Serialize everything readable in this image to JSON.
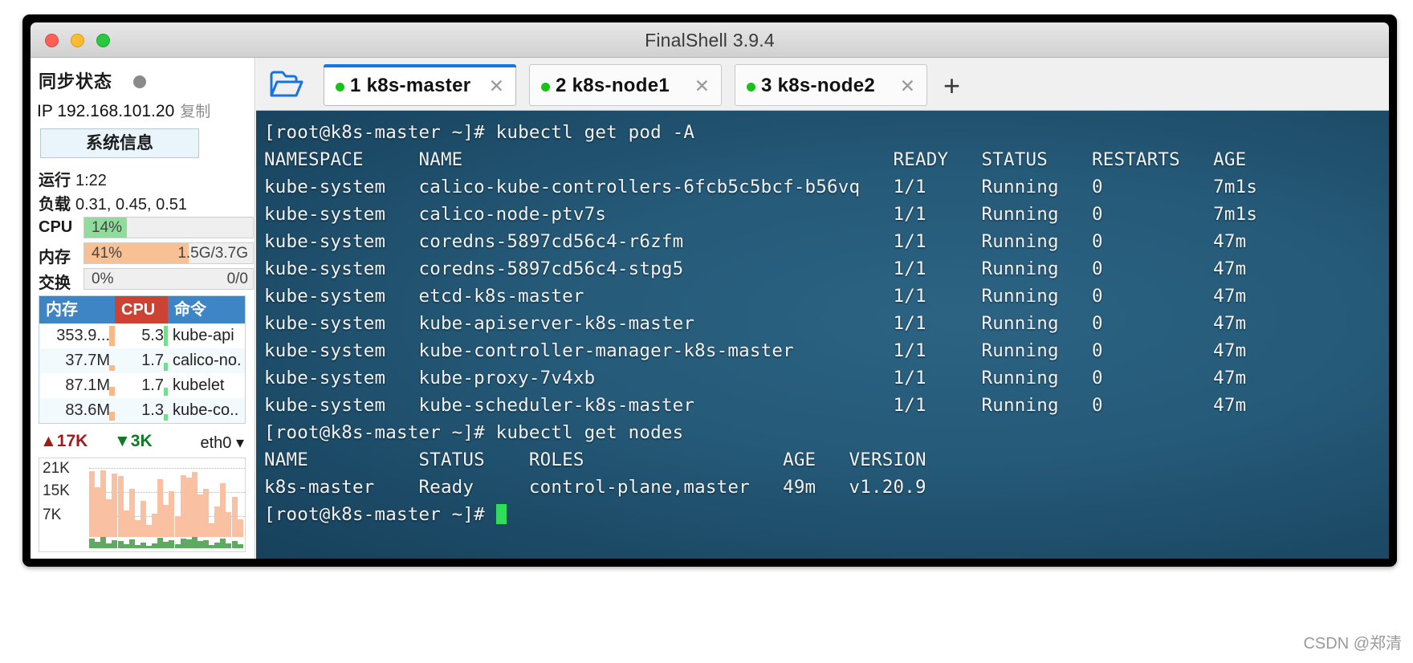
{
  "window": {
    "title": "FinalShell 3.9.4",
    "traffic_lights": [
      "close",
      "minimize",
      "maximize"
    ]
  },
  "sidebar": {
    "sync_label": "同步状态",
    "ip_prefix": "IP",
    "ip_address": "192.168.101.20",
    "copy_label": "复制",
    "sysinfo_button": "系统信息",
    "uptime_label": "运行",
    "uptime_value": "1:22",
    "load_label": "负载",
    "load_value": "0.31, 0.45, 0.51",
    "metrics": [
      {
        "name": "CPU",
        "percent": "14%",
        "value": "",
        "fill_pct": 25,
        "fill_color": "#8fdd9b"
      },
      {
        "name": "内存",
        "percent": "41%",
        "value": "1.5G/3.7G",
        "fill_pct": 62,
        "fill_color": "#f9c193"
      },
      {
        "name": "交换",
        "percent": "0%",
        "value": "0/0",
        "fill_pct": 0,
        "fill_color": "#f9c193"
      }
    ],
    "process_table": {
      "headers": [
        "内存",
        "CPU",
        "命令"
      ],
      "rows": [
        {
          "mem": "353.9...",
          "cpu": "5.3",
          "cmd": "kube-api",
          "mem_bar": 100,
          "cpu_bar": 100
        },
        {
          "mem": "37.7M",
          "cpu": "1.7",
          "cmd": "calico-no.",
          "mem_bar": 30,
          "cpu_bar": 40
        },
        {
          "mem": "87.1M",
          "cpu": "1.7",
          "cmd": "kubelet",
          "mem_bar": 45,
          "cpu_bar": 40
        },
        {
          "mem": "83.6M",
          "cpu": "1.3",
          "cmd": "kube-co..",
          "mem_bar": 43,
          "cpu_bar": 32
        }
      ]
    },
    "network": {
      "up_value": "17K",
      "down_value": "3K",
      "interface": "eth0",
      "y_ticks": [
        "21K",
        "15K",
        "7K"
      ],
      "bars": [
        95,
        72,
        96,
        55,
        92,
        88,
        38,
        70,
        24,
        52,
        18,
        34,
        84,
        46,
        66,
        30,
        90,
        86,
        94,
        62,
        70,
        20,
        44,
        78,
        36,
        58,
        26
      ],
      "baseline_bars": [
        12,
        8,
        14,
        6,
        10,
        9,
        5,
        11,
        4,
        7,
        3,
        6,
        13,
        8,
        10,
        5,
        12,
        11,
        14,
        9,
        10,
        4,
        7,
        12,
        6,
        9,
        5
      ]
    }
  },
  "tabs": {
    "folder_icon": "folder-open-icon",
    "add_label": "+",
    "close_glyph": "✕",
    "items": [
      {
        "label": "1 k8s-master",
        "active": true,
        "status": "connected"
      },
      {
        "label": "2 k8s-node1",
        "active": false,
        "status": "connected"
      },
      {
        "label": "3 k8s-node2",
        "active": false,
        "status": "connected"
      }
    ]
  },
  "terminal": {
    "lines": [
      "[root@k8s-master ~]# kubectl get pod -A",
      "NAMESPACE     NAME                                       READY   STATUS    RESTARTS   AGE",
      "kube-system   calico-kube-controllers-6fcb5c5bcf-b56vq   1/1     Running   0          7m1s",
      "kube-system   calico-node-ptv7s                          1/1     Running   0          7m1s",
      "kube-system   coredns-5897cd56c4-r6zfm                   1/1     Running   0          47m",
      "kube-system   coredns-5897cd56c4-stpg5                   1/1     Running   0          47m",
      "kube-system   etcd-k8s-master                            1/1     Running   0          47m",
      "kube-system   kube-apiserver-k8s-master                  1/1     Running   0          47m",
      "kube-system   kube-controller-manager-k8s-master         1/1     Running   0          47m",
      "kube-system   kube-proxy-7v4xb                           1/1     Running   0          47m",
      "kube-system   kube-scheduler-k8s-master                  1/1     Running   0          47m",
      "[root@k8s-master ~]# kubectl get nodes",
      "NAME          STATUS    ROLES                  AGE   VERSION",
      "k8s-master    Ready     control-plane,master   49m   v1.20.9"
    ],
    "prompt": "[root@k8s-master ~]# "
  },
  "watermark": "CSDN @郑清"
}
